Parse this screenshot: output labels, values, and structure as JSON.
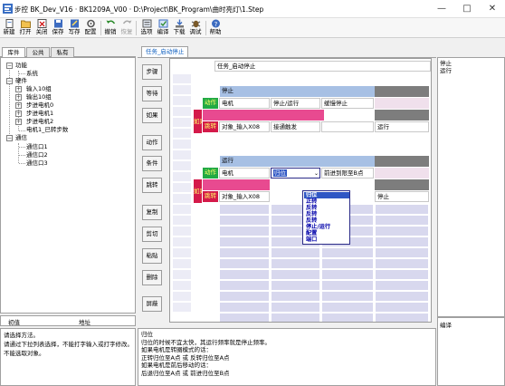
{
  "window": {
    "title": "步控  BK_Dev_V16   ·  BK1209A_V00  ·  D:\\Project\\BK_Program\\曲时亮灯\\1.Step",
    "controls": [
      "—",
      "□",
      "✕"
    ]
  },
  "toolbar": {
    "items": [
      {
        "label": "新建",
        "icon": "new-file-icon",
        "enabled": true
      },
      {
        "label": "打开",
        "icon": "open-folder-icon",
        "enabled": true
      },
      {
        "label": "关闭",
        "icon": "close-file-icon",
        "enabled": true
      },
      {
        "label": "保存",
        "icon": "save-icon",
        "enabled": true
      },
      {
        "label": "写存",
        "icon": "write-icon",
        "enabled": true
      },
      {
        "label": "配置",
        "icon": "config-icon",
        "enabled": true
      },
      {
        "label": "撤销",
        "icon": "undo-icon",
        "enabled": true
      },
      {
        "label": "恢复",
        "icon": "redo-icon",
        "enabled": false
      },
      {
        "label": "选项",
        "icon": "options-icon",
        "enabled": true
      },
      {
        "label": "编译",
        "icon": "compile-icon",
        "enabled": true
      },
      {
        "label": "下载",
        "icon": "download-icon",
        "enabled": true
      },
      {
        "label": "调试",
        "icon": "debug-icon",
        "enabled": true
      },
      {
        "label": "帮助",
        "icon": "help-icon",
        "enabled": true
      }
    ]
  },
  "left_panel": {
    "tabs": [
      "库件",
      "公共",
      "私有"
    ],
    "active_tab": "库件",
    "tree": [
      {
        "label": "功能",
        "level": 0,
        "expander": "-"
      },
      {
        "label": "系统",
        "level": 1,
        "expander": ""
      },
      {
        "label": "硬件",
        "level": 0,
        "expander": "-"
      },
      {
        "label": "输入10组",
        "level": 1,
        "expander": "+"
      },
      {
        "label": "输出10组",
        "level": 1,
        "expander": "+"
      },
      {
        "label": "步进电机0",
        "level": 1,
        "expander": "+"
      },
      {
        "label": "步进电机1",
        "level": 1,
        "expander": "+"
      },
      {
        "label": "步进电机2",
        "level": 1,
        "expander": "+"
      },
      {
        "label": "电机1_已转步数",
        "level": 1,
        "expander": ""
      },
      {
        "label": "通信",
        "level": 0,
        "expander": "-"
      },
      {
        "label": "通信口1",
        "level": 1,
        "expander": ""
      },
      {
        "label": "通信口2",
        "level": 1,
        "expander": ""
      },
      {
        "label": "通信口3",
        "level": 1,
        "expander": ""
      }
    ],
    "grid_headers": [
      "初值",
      "地址"
    ],
    "hint_lines": [
      "请选择方法。",
      "",
      "请通过下拉列表选择，不能打字输入或打字修改。",
      "不能选取对象。"
    ]
  },
  "editor": {
    "tab_label": "任务_启动停止",
    "side_buttons": [
      "步骤",
      "等待",
      "如果",
      "动作",
      "条件",
      "跳转",
      "复制",
      "剪切",
      "粘贴",
      "删除",
      "屏蔽"
    ],
    "task_header": "任务_启动停止",
    "block1": {
      "header": "停止",
      "action_tag": "动作",
      "action_cells": [
        "电机",
        "停止/运行",
        "缓慢停止"
      ],
      "if_tag": "如果",
      "jump_tag": "跳转",
      "jump_cells": [
        "对象_输入X08",
        "接通触发",
        "",
        "运行"
      ]
    },
    "block2": {
      "header": "运行",
      "action_tag": "动作",
      "action_cells": [
        "电机",
        "归位",
        "前进到限至B点"
      ],
      "if_tag": "如果",
      "jump_tag": "跳转",
      "jump_cells": [
        "对象_输入X08",
        "",
        "",
        "停止"
      ]
    },
    "dropdown": {
      "options": [
        "归位",
        "正转",
        "反转",
        "反转",
        "反转",
        "停止/运行",
        "配置",
        "端口"
      ],
      "selected_index": 0
    }
  },
  "description": {
    "lines": [
      "归位",
      "归位的时候不宜太快，其运行频率就是停止频率。",
      "如果电机是转圈模式的话：",
      "正转归位至A点 或 反转归位至A点",
      "如果电机是前后移动的话：",
      "后退归位至A点 或 前进归位至B点"
    ]
  },
  "right_panel": {
    "top_lines": [
      "停止",
      "运行"
    ],
    "bottom_label": "编译"
  }
}
